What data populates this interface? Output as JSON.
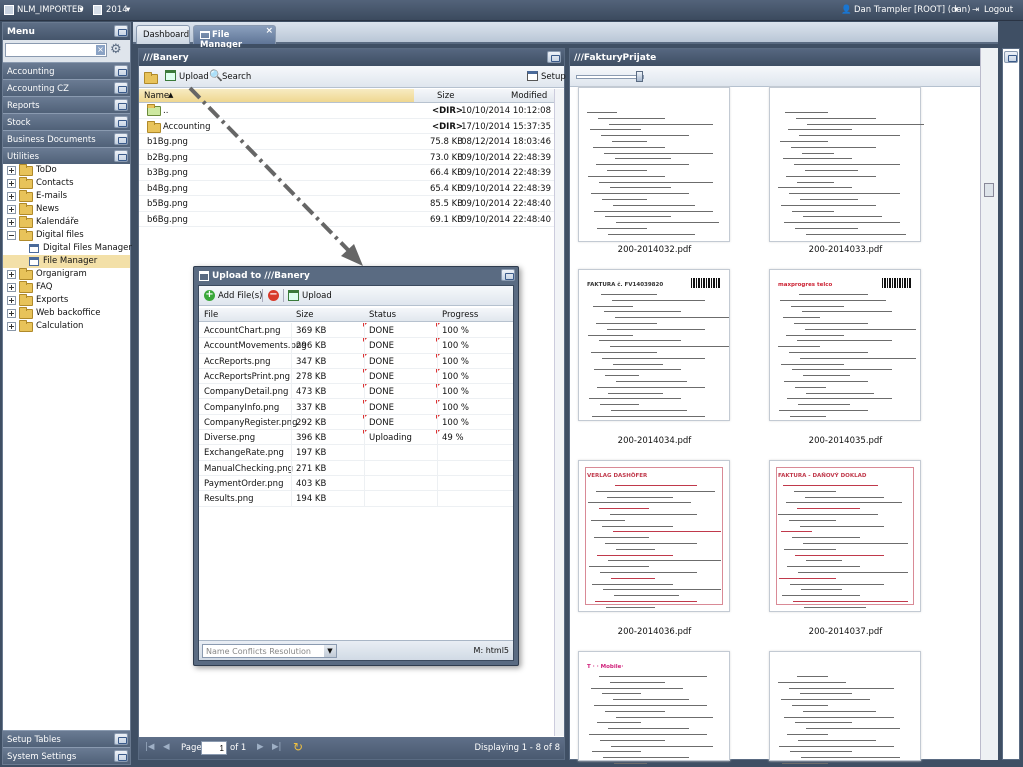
{
  "topbar": {
    "org": "NLM_IMPORTED",
    "year": "2014",
    "user": "Dan Trampler [ROOT] (dan)",
    "logout": "Logout"
  },
  "sidebar": {
    "menu_title": "Menu",
    "search_placeholder": "",
    "sections": [
      "Accounting",
      "Accounting CZ",
      "Reports",
      "Stock",
      "Business Documents",
      "Utilities"
    ],
    "utilities_items": [
      {
        "label": "ToDo"
      },
      {
        "label": "Contacts"
      },
      {
        "label": "E-mails"
      },
      {
        "label": "News"
      },
      {
        "label": "Kalendáře"
      },
      {
        "label": "Digital files"
      },
      {
        "label": "Digital Files Manager"
      },
      {
        "label": "File Manager"
      },
      {
        "label": "Organigram"
      },
      {
        "label": "FAQ"
      },
      {
        "label": "Exports"
      },
      {
        "label": "Web backoffice"
      },
      {
        "label": "Calculation"
      }
    ],
    "bottom_sections": [
      "Setup Tables",
      "System Settings"
    ]
  },
  "tabs": [
    {
      "label": "Dashboard"
    },
    {
      "label": "File Manager"
    }
  ],
  "left_panel": {
    "title": "///Banery",
    "toolbar": {
      "upload": "Upload",
      "search": "Search",
      "setup": "Setup"
    },
    "columns": {
      "name": "Name",
      "size": "Size",
      "modified": "Modified"
    },
    "rows": [
      {
        "name": "..",
        "size": "<DIR>",
        "modified": "10/10/2014 10:12:08"
      },
      {
        "name": "Accounting",
        "size": "<DIR>",
        "modified": "17/10/2014 15:37:35"
      },
      {
        "name": "b1Bg.png",
        "size": "75.8 KB",
        "modified": "08/12/2014 18:03:46"
      },
      {
        "name": "b2Bg.png",
        "size": "73.0 KB",
        "modified": "09/10/2014 22:48:39"
      },
      {
        "name": "b3Bg.png",
        "size": "66.4 KB",
        "modified": "09/10/2014 22:48:39"
      },
      {
        "name": "b4Bg.png",
        "size": "65.4 KB",
        "modified": "09/10/2014 22:48:39"
      },
      {
        "name": "b5Bg.png",
        "size": "85.5 KB",
        "modified": "09/10/2014 22:48:40"
      },
      {
        "name": "b6Bg.png",
        "size": "69.1 KB",
        "modified": "09/10/2014 22:48:40"
      }
    ],
    "pager": {
      "page_label": "Page",
      "page_value": "1",
      "of_label": "of 1",
      "display": "Displaying 1 - 8 of 8"
    }
  },
  "upload_dialog": {
    "title": "Upload to ///Banery",
    "add_files": "Add File(s)",
    "upload": "Upload",
    "columns": {
      "file": "File",
      "size": "Size",
      "status": "Status",
      "progress": "Progress"
    },
    "rows": [
      {
        "file": "AccountChart.png",
        "size": "369 KB",
        "status": "DONE",
        "progress": "100 %"
      },
      {
        "file": "AccountMovements.png",
        "size": "296 KB",
        "status": "DONE",
        "progress": "100 %"
      },
      {
        "file": "AccReports.png",
        "size": "347 KB",
        "status": "DONE",
        "progress": "100 %"
      },
      {
        "file": "AccReportsPrint.png",
        "size": "278 KB",
        "status": "DONE",
        "progress": "100 %"
      },
      {
        "file": "CompanyDetail.png",
        "size": "473 KB",
        "status": "DONE",
        "progress": "100 %"
      },
      {
        "file": "CompanyInfo.png",
        "size": "337 KB",
        "status": "DONE",
        "progress": "100 %"
      },
      {
        "file": "CompanyRegister.png",
        "size": "292 KB",
        "status": "DONE",
        "progress": "100 %"
      },
      {
        "file": "Diverse.png",
        "size": "396 KB",
        "status": "Uploading",
        "progress": "49 %"
      },
      {
        "file": "ExchangeRate.png",
        "size": "197 KB",
        "status": "",
        "progress": ""
      },
      {
        "file": "ManualChecking.png",
        "size": "271 KB",
        "status": "",
        "progress": ""
      },
      {
        "file": "PaymentOrder.png",
        "size": "403 KB",
        "status": "",
        "progress": ""
      },
      {
        "file": "Results.png",
        "size": "194 KB",
        "status": "",
        "progress": ""
      }
    ],
    "conflicts_placeholder": "Name Conflicts Resolution",
    "runtime": "M: html5"
  },
  "right_panel": {
    "title": "///FakturyPrijate",
    "files": [
      {
        "name": "200-2014032.pdf"
      },
      {
        "name": "200-2014033.pdf"
      },
      {
        "name": "200-2014034.pdf"
      },
      {
        "name": "200-2014035.pdf"
      },
      {
        "name": "200-2014036.pdf"
      },
      {
        "name": "200-2014037.pdf"
      },
      {
        "name": ""
      },
      {
        "name": ""
      }
    ],
    "doc_text": {
      "faktura": "FAKTURA č. FV14039820",
      "maxprogres": "maxprogres telco",
      "danovy": "FAKTURA - DAŇOVÝ DOKLAD",
      "verlag": "VERLAG DASHÖFER",
      "tmobile": "T · · Mobile·"
    }
  }
}
